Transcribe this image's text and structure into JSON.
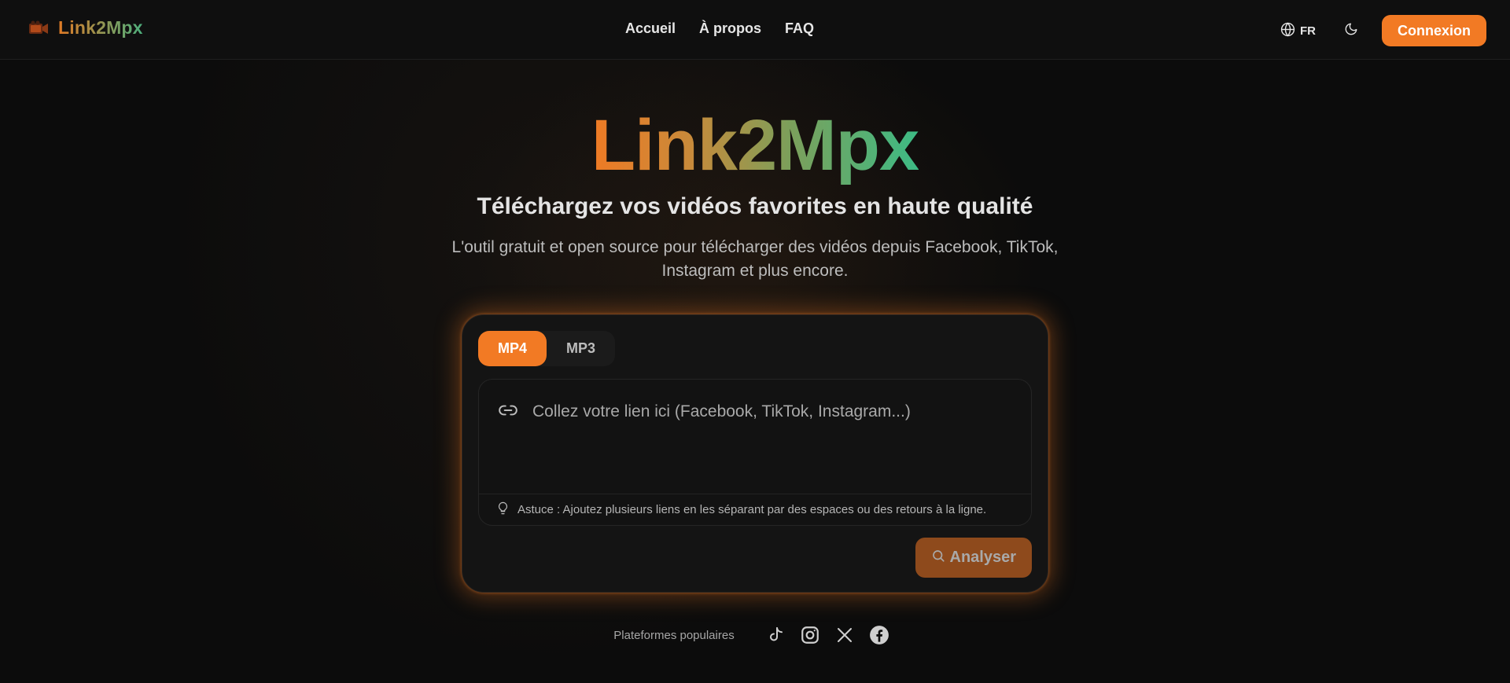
{
  "navbar": {
    "brand": "Link2Mpx",
    "links": [
      "Accueil",
      "À propos",
      "FAQ"
    ],
    "language": "FR",
    "login_label": "Connexion"
  },
  "hero": {
    "title": "Link2Mpx",
    "subtitle": "Téléchargez vos vidéos favorites en haute qualité",
    "description": "L'outil gratuit et open source pour télécharger des vidéos depuis Facebook, TikTok, Instagram et plus encore."
  },
  "downloader": {
    "tabs": [
      "MP4",
      "MP3"
    ],
    "active_tab": "MP4",
    "input_placeholder": "Collez votre lien ici (Facebook, TikTok, Instagram...)",
    "input_value": "",
    "tip": "Astuce : Ajoutez plusieurs liens en les séparant par des espaces ou des retours à la ligne.",
    "analyze_label": "Analyser"
  },
  "platforms": {
    "label": "Plateformes populaires",
    "icons": [
      "tiktok-icon",
      "instagram-icon",
      "x-icon",
      "facebook-icon"
    ]
  },
  "colors": {
    "accent": "#f27a24",
    "gradient_start": "#ef7a24",
    "gradient_end": "#3dbb85",
    "background": "#0c0c0c"
  }
}
